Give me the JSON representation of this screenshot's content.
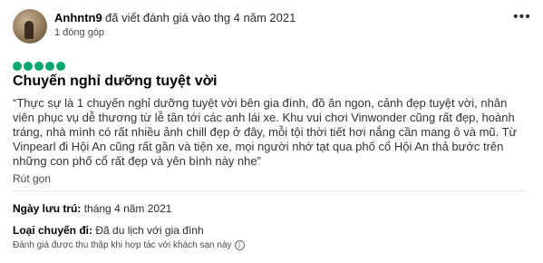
{
  "reviewer": {
    "username": "Anhntn9",
    "wrote_text": "đã viết đánh giá vào thg 4 năm 2021",
    "contributions": "1 đóng góp"
  },
  "more_icon": "more-horizontal-icon",
  "rating": {
    "value": 5,
    "max": 5,
    "color": "#00aa6c"
  },
  "review": {
    "title": "Chuyến nghỉ dưỡng tuyệt vời",
    "body": "“Thực sự là 1 chuyến nghỉ dưỡng tuyệt vời bên gia đình, đồ ăn ngon, cảnh đẹp tuyệt vời, nhân viên phục vụ dễ thương từ lễ tân tới các anh lái xe. Khu vui chơi Vinwonder cũng rất đẹp, hoành tráng, nhà mình có rất nhiều ảnh chill đẹp ở đây, mỗi tội thời tiết hơi nắng cần mang ô và mũ. Từ Vinpearl đi Hội An cũng rất gần và tiện xe, mọi người nhớ tạt qua phố cổ Hội An thả bước trên những con phố cổ rất đẹp và yên bình này nhe”",
    "collapse_label": "Rút gọn"
  },
  "details": {
    "stay_label": "Ngày lưu trú:",
    "stay_value": "tháng 4 năm 2021",
    "trip_label": "Loại chuyến đi:",
    "trip_value": "Đã du lịch với gia đình"
  },
  "collection_note": "Đánh giá được thu thập khi hợp tác với khách sạn này",
  "info_icon": "info-icon"
}
